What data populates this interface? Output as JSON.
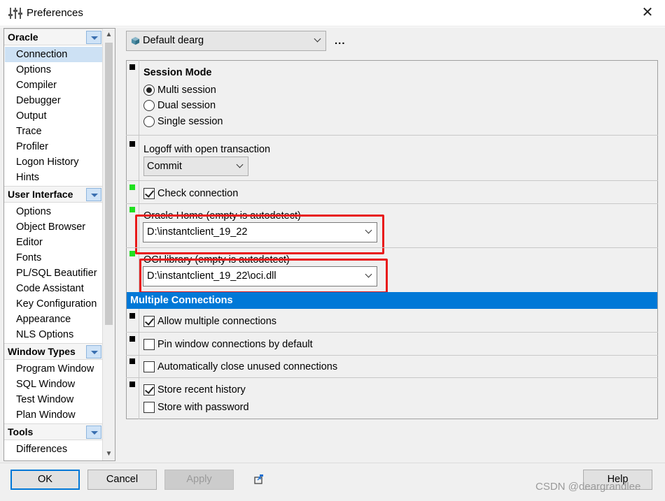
{
  "window": {
    "title": "Preferences"
  },
  "nav": {
    "groups": [
      {
        "label": "Oracle",
        "items": [
          "Connection",
          "Options",
          "Compiler",
          "Debugger",
          "Output",
          "Trace",
          "Profiler",
          "Logon History",
          "Hints"
        ]
      },
      {
        "label": "User Interface",
        "items": [
          "Options",
          "Object Browser",
          "Editor",
          "Fonts",
          "PL/SQL Beautifier",
          "Code Assistant",
          "Key Configuration",
          "Appearance",
          "NLS Options"
        ]
      },
      {
        "label": "Window Types",
        "items": [
          "Program Window",
          "SQL Window",
          "Test Window",
          "Plan Window"
        ]
      },
      {
        "label": "Tools",
        "items": [
          "Differences"
        ]
      }
    ],
    "selected": "Connection"
  },
  "profile": {
    "selected": "Default dearg",
    "more": "..."
  },
  "session_mode": {
    "heading": "Session Mode",
    "options": [
      "Multi session",
      "Dual session",
      "Single session"
    ],
    "selected": "Multi session"
  },
  "logoff": {
    "label": "Logoff with open transaction",
    "value": "Commit"
  },
  "check_connection": {
    "label": "Check connection",
    "checked": true
  },
  "oracle_home": {
    "label": "Oracle Home (empty is autodetect)",
    "value": "D:\\instantclient_19_22"
  },
  "oci_library": {
    "label": "OCI library (empty is autodetect)",
    "value": "D:\\instantclient_19_22\\oci.dll"
  },
  "multiple_connections": {
    "heading": "Multiple Connections",
    "allow": {
      "label": "Allow multiple connections",
      "checked": true
    },
    "pin": {
      "label": "Pin window connections by default",
      "checked": false
    },
    "auto_close": {
      "label": "Automatically close unused connections",
      "checked": false
    },
    "store_history": {
      "label": "Store recent history",
      "checked": true
    },
    "store_password": {
      "label": "Store with password",
      "checked": false
    }
  },
  "buttons": {
    "ok": "OK",
    "cancel": "Cancel",
    "apply": "Apply",
    "help": "Help"
  },
  "watermark": "CSDN @deargrandlee",
  "colors": {
    "section_bar": "#0078d7",
    "highlight_box": "#e81a1a",
    "marker_green": "#20e020",
    "selected_item": "#cde1f4"
  }
}
